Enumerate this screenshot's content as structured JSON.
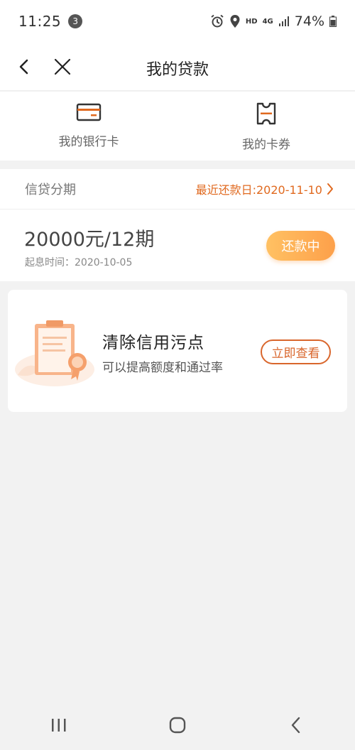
{
  "status_bar": {
    "time": "11:25",
    "notification_count": "3",
    "hd": "HD",
    "network": "4G",
    "battery": "74%"
  },
  "nav": {
    "title": "我的贷款"
  },
  "quick_links": [
    {
      "label": "我的银行卡",
      "icon": "bank-card-icon"
    },
    {
      "label": "我的卡券",
      "icon": "coupon-icon"
    }
  ],
  "loan": {
    "category": "信贷分期",
    "next_due_label": "最近还款日:2020-11-10",
    "amount_terms": "20000元/12期",
    "start_date": "起息时间：2020-10-05",
    "status": "还款中"
  },
  "promo": {
    "title": "清除信用污点",
    "subtitle": "可以提高额度和通过率",
    "button": "立即查看"
  },
  "colors": {
    "accent": "#e0691f",
    "status_gradient_start": "#ffc163",
    "status_gradient_end": "#fda04a"
  }
}
